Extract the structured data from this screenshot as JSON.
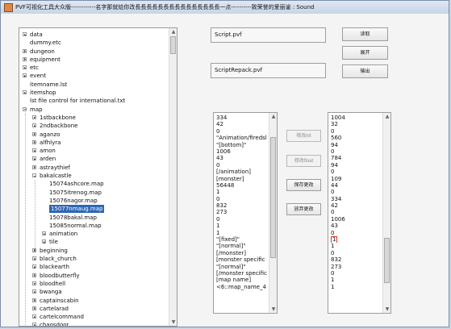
{
  "window": {
    "title": "PVF可视化工具大众版------------名字那就给你改長長長長長長長長長長長長長長長一点----------致荣誉的爱丽谕 : Sound"
  },
  "tree": {
    "items": [
      {
        "label": "data",
        "depth": 0,
        "expander": "plus"
      },
      {
        "label": "dummy.etc",
        "depth": 0,
        "expander": "none"
      },
      {
        "label": "dungeon",
        "depth": 0,
        "expander": "plus"
      },
      {
        "label": "equipment",
        "depth": 0,
        "expander": "plus"
      },
      {
        "label": "etc",
        "depth": 0,
        "expander": "plus"
      },
      {
        "label": "event",
        "depth": 0,
        "expander": "plus"
      },
      {
        "label": "itemname.lst",
        "depth": 0,
        "expander": "none"
      },
      {
        "label": "itemshop",
        "depth": 0,
        "expander": "plus"
      },
      {
        "label": "lst file control for international.txt",
        "depth": 0,
        "expander": "none"
      },
      {
        "label": "map",
        "depth": 0,
        "expander": "minus"
      },
      {
        "label": "1stbackbone",
        "depth": 1,
        "expander": "plus"
      },
      {
        "label": "2ndbackbone",
        "depth": 1,
        "expander": "plus"
      },
      {
        "label": "aganzo",
        "depth": 1,
        "expander": "plus"
      },
      {
        "label": "alfhlyra",
        "depth": 1,
        "expander": "plus"
      },
      {
        "label": "amon",
        "depth": 1,
        "expander": "plus"
      },
      {
        "label": "arden",
        "depth": 1,
        "expander": "plus"
      },
      {
        "label": "astraythief",
        "depth": 1,
        "expander": "plus"
      },
      {
        "label": "bakalcastle",
        "depth": 1,
        "expander": "minus"
      },
      {
        "label": "15074ashcore.map",
        "depth": 2,
        "expander": "none"
      },
      {
        "label": "15075itrenog.map",
        "depth": 2,
        "expander": "none"
      },
      {
        "label": "15076nagor.map",
        "depth": 2,
        "expander": "none"
      },
      {
        "label": "15077nmaug.map",
        "depth": 2,
        "expander": "none",
        "selected": true
      },
      {
        "label": "15078bakal.map",
        "depth": 2,
        "expander": "none"
      },
      {
        "label": "15085normal.map",
        "depth": 2,
        "expander": "none"
      },
      {
        "label": "animation",
        "depth": 2,
        "expander": "plus"
      },
      {
        "label": "tile",
        "depth": 2,
        "expander": "plus"
      },
      {
        "label": "beginning",
        "depth": 1,
        "expander": "plus"
      },
      {
        "label": "black_church",
        "depth": 1,
        "expander": "plus"
      },
      {
        "label": "blackearth",
        "depth": 1,
        "expander": "plus"
      },
      {
        "label": "bloodbutterfly",
        "depth": 1,
        "expander": "plus"
      },
      {
        "label": "bloodhell",
        "depth": 1,
        "expander": "plus"
      },
      {
        "label": "bwanga",
        "depth": 1,
        "expander": "plus"
      },
      {
        "label": "captainscabin",
        "depth": 1,
        "expander": "plus"
      },
      {
        "label": "cartelarad",
        "depth": 1,
        "expander": "plus"
      },
      {
        "label": "cartelcommand",
        "depth": 1,
        "expander": "plus"
      },
      {
        "label": "chaosdoor",
        "depth": 1,
        "expander": "plus"
      }
    ]
  },
  "fields": {
    "script_path": "Script.pvf",
    "repack_path": "ScriptRepack.pvf"
  },
  "buttons": {
    "read": "读取",
    "open": "展开",
    "export": "输出",
    "modify_int": "修改int",
    "modify_float": "修改float",
    "save_changes": "保存更改",
    "discard_changes": "放弃更改"
  },
  "text_list": {
    "rows": [
      "334",
      "42",
      "0",
      "\"Animation/firedsl",
      "\"[bottom]\"",
      "1006",
      "43",
      "0",
      "[/animation]",
      "[monster]",
      "56448",
      "1",
      "0",
      "832",
      "273",
      "0",
      "1",
      "1",
      "\"[fixed]\"",
      "\"[normal]\"",
      "[/monster]",
      "[monster specific",
      "\"[normal]\"",
      "[/monster specific",
      "[map name]",
      "<6::map_name_4"
    ]
  },
  "value_list": {
    "rows": [
      "1004",
      "32",
      "0",
      "560",
      "94",
      "0",
      "784",
      "94",
      "0",
      "109",
      "44",
      "0",
      "334",
      "42",
      "0",
      "1006",
      "43",
      "0",
      "1",
      "1",
      "0",
      "832",
      "273",
      "0",
      "1",
      "1"
    ],
    "highlighted_index": 18
  },
  "colors": {
    "selection": "#2e67b4",
    "highlight_border": "#d6362f"
  }
}
